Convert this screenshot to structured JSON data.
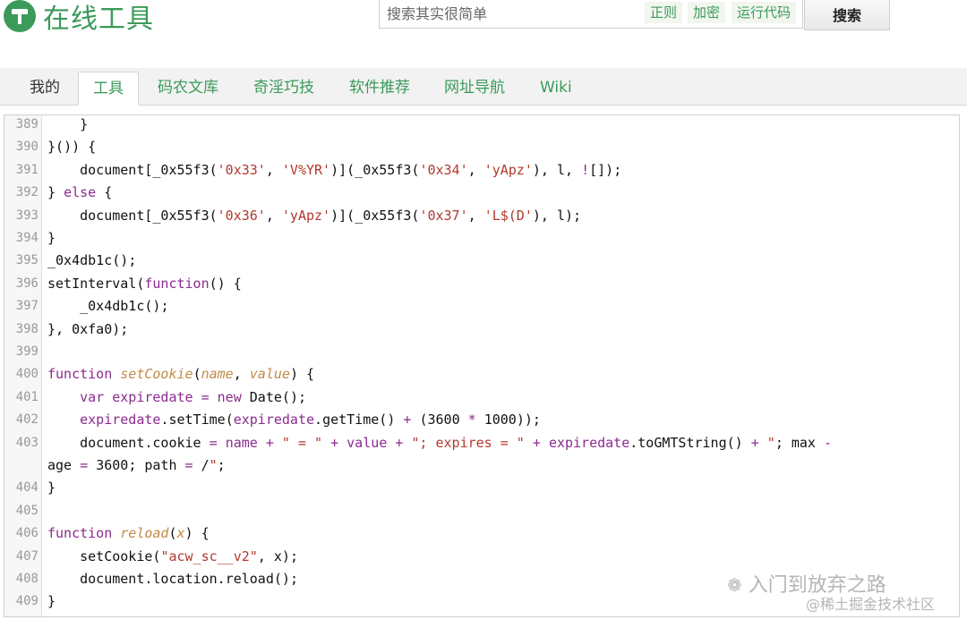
{
  "header": {
    "logo_text": "在线工具",
    "search_placeholder": "搜索其实很简单",
    "tags": [
      "正则",
      "加密",
      "运行代码"
    ],
    "search_button": "搜索"
  },
  "tabs": [
    "我的",
    "工具",
    "码农文库",
    "奇淫巧技",
    "软件推荐",
    "网址导航",
    "Wiki"
  ],
  "watermark": {
    "line1": "入门到放弃之路",
    "line2": "@稀土掘金技术社区"
  },
  "code_lines": [
    {
      "n": "389",
      "t": "    }"
    },
    {
      "n": "390",
      "t": "}()) {"
    },
    {
      "n": "391",
      "t": "    document[_0x55f3('0x33', 'V%YR')](_0x55f3('0x34', 'yApz'), l, ![]);"
    },
    {
      "n": "392",
      "t": "} else {"
    },
    {
      "n": "393",
      "t": "    document[_0x55f3('0x36', 'yApz')](_0x55f3('0x37', 'L$(D'), l);"
    },
    {
      "n": "394",
      "t": "}"
    },
    {
      "n": "395",
      "t": "_0x4db1c();"
    },
    {
      "n": "396",
      "t": "setInterval(function() {"
    },
    {
      "n": "397",
      "t": "    _0x4db1c();"
    },
    {
      "n": "398",
      "t": "}, 0xfa0);"
    },
    {
      "n": "399",
      "t": ""
    },
    {
      "n": "400",
      "t": "function setCookie(name, value) {"
    },
    {
      "n": "401",
      "t": "    var expiredate = new Date();"
    },
    {
      "n": "402",
      "t": "    expiredate.setTime(expiredate.getTime() + (3600 * 1000));"
    },
    {
      "n": "403",
      "t": "    document.cookie = name + \" = \" + value + \"; expires = \" + expiredate.toGMTString() + \"; max -"
    },
    {
      "n": "",
      "t": "age = 3600; path = /\";"
    },
    {
      "n": "404",
      "t": "}"
    },
    {
      "n": "405",
      "t": ""
    },
    {
      "n": "406",
      "t": "function reload(x) {"
    },
    {
      "n": "407",
      "t": "    setCookie(\"acw_sc__v2\", x);"
    },
    {
      "n": "408",
      "t": "    document.location.reload();"
    },
    {
      "n": "409",
      "t": "}"
    }
  ]
}
